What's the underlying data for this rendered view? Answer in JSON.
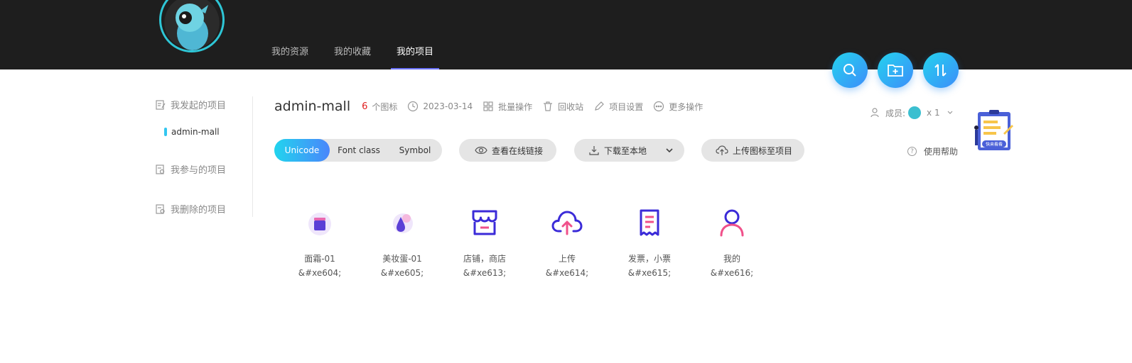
{
  "nav": {
    "tabs": [
      {
        "label": "我的资源"
      },
      {
        "label": "我的收藏"
      },
      {
        "label": "我的项目",
        "active": true
      }
    ]
  },
  "fabs": [
    {
      "icon": "search-icon"
    },
    {
      "icon": "add-folder-icon"
    },
    {
      "icon": "sort-icon"
    }
  ],
  "sidebar": {
    "started": "我发起的项目",
    "sub_item": "admin-mall",
    "joined": "我参与的项目",
    "deleted": "我删除的项目"
  },
  "project": {
    "title": "admin-mall",
    "count": "6",
    "count_unit": "个图标",
    "date": "2023-03-14",
    "batch": "批量操作",
    "recycle": "回收站",
    "settings": "项目设置",
    "more": "更多操作",
    "members_label": "成员:",
    "members_count": "x 1",
    "help": "使用帮助",
    "illustration_text": "快来看看"
  },
  "toolbar": {
    "modes": [
      "Unicode",
      "Font class",
      "Symbol"
    ],
    "active_mode": "Unicode",
    "view_link": "查看在线链接",
    "download": "下载至本地",
    "upload": "上传图标至项目"
  },
  "icons": [
    {
      "name": "面霜-01",
      "code": "&#xe604;",
      "icon": "cream-icon"
    },
    {
      "name": "美妆蛋-01",
      "code": "&#xe605;",
      "icon": "beauty-egg-icon"
    },
    {
      "name": "店铺，商店",
      "code": "&#xe613;",
      "icon": "store-icon"
    },
    {
      "name": "上传",
      "code": "&#xe614;",
      "icon": "cloud-upload-icon"
    },
    {
      "name": "发票，小票",
      "code": "&#xe615;",
      "icon": "receipt-icon"
    },
    {
      "name": "我的",
      "code": "&#xe616;",
      "icon": "user-icon"
    }
  ],
  "colors": {
    "accent": "#4a86fb",
    "accent_start": "#21d4ee",
    "topbar": "#1e1e1e",
    "count": "#e02020",
    "icon_primary": "#3b2bd8",
    "icon_secondary": "#f0508a"
  }
}
